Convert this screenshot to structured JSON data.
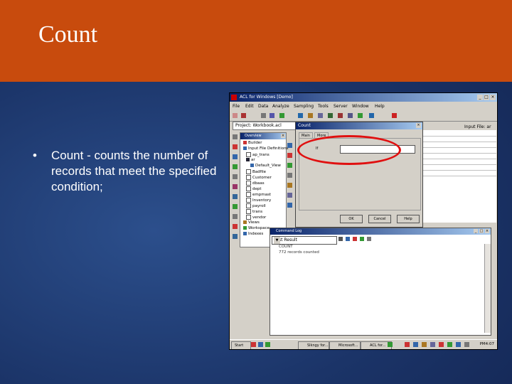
{
  "slide": {
    "title": "Count",
    "bullet": "Count - counts the number of records that meet the specified condition;"
  },
  "colors": {
    "title_band": "#c84b0d",
    "background": "#1b3468",
    "highlight_ellipse": "#e01010"
  },
  "app": {
    "title": "ACL for Windows [Demo]",
    "menu": [
      "File",
      "Edit",
      "Data",
      "Analyze",
      "Sampling",
      "Tools",
      "Server",
      "Window",
      "Help"
    ],
    "project_label": "Project: Workbook.acl",
    "input_file_label": "Input File: ar"
  },
  "tree": {
    "header": "Overview",
    "items": [
      "Builder",
      "Input File Definitions",
      "ap_trans",
      "ar",
      "Default_View",
      "Badfile",
      "Customer",
      "dbaas",
      "dept",
      "empmast",
      "Inventory",
      "payroll",
      "trans",
      "vendor",
      "Views",
      "Workspace",
      "Indexes"
    ]
  },
  "dialog": {
    "title": "Count",
    "tabs": [
      "Main",
      "More"
    ],
    "if_label": "If",
    "if_value": "",
    "ok_label": "OK",
    "cancel_label": "Cancel",
    "help_label": "Help"
  },
  "log": {
    "title": "Command Log",
    "select_value": "Last Result",
    "lines": [
      "COUNT",
      "772 records counted"
    ]
  },
  "taskbar": {
    "start": "Start",
    "tasks": [
      "Slkngy for...",
      "Microsoft...",
      "ACL for..."
    ],
    "clock": "PM4:07"
  }
}
